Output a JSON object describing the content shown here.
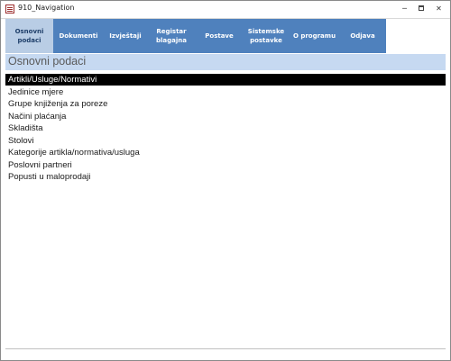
{
  "window": {
    "title": "910_Navigation",
    "icon": "access-form-icon",
    "controls": {
      "minimize": "─",
      "maximize": "maximize-icon",
      "close": "✕"
    }
  },
  "nav": {
    "tabs": [
      {
        "label": "Osnovni\npodaci",
        "active": true
      },
      {
        "label": "Dokumenti",
        "active": false
      },
      {
        "label": "Izvještaji",
        "active": false
      },
      {
        "label": "Registar\nblagajna",
        "active": false
      },
      {
        "label": "Postave",
        "active": false
      },
      {
        "label": "Sistemske\npostavke",
        "active": false
      },
      {
        "label": "O programu",
        "active": false
      },
      {
        "label": "Odjava",
        "active": false
      }
    ]
  },
  "section": {
    "title": "Osnovni podaci"
  },
  "list": {
    "items": [
      "Artikli/Usluge/Normativi",
      "Jedinice mjere",
      "Grupe knjiženja za poreze",
      "Načini plaćanja",
      "Skladišta",
      "Stolovi",
      "Kategorije artikla/normativa/usluga",
      "Poslovni partneri",
      "Popusti u maloprodaji"
    ],
    "selected_index": 0
  },
  "colors": {
    "nav_background": "#4f81bd",
    "nav_active": "#b9cde5",
    "section_header": "#c6d9f1",
    "selection": "#000000"
  }
}
